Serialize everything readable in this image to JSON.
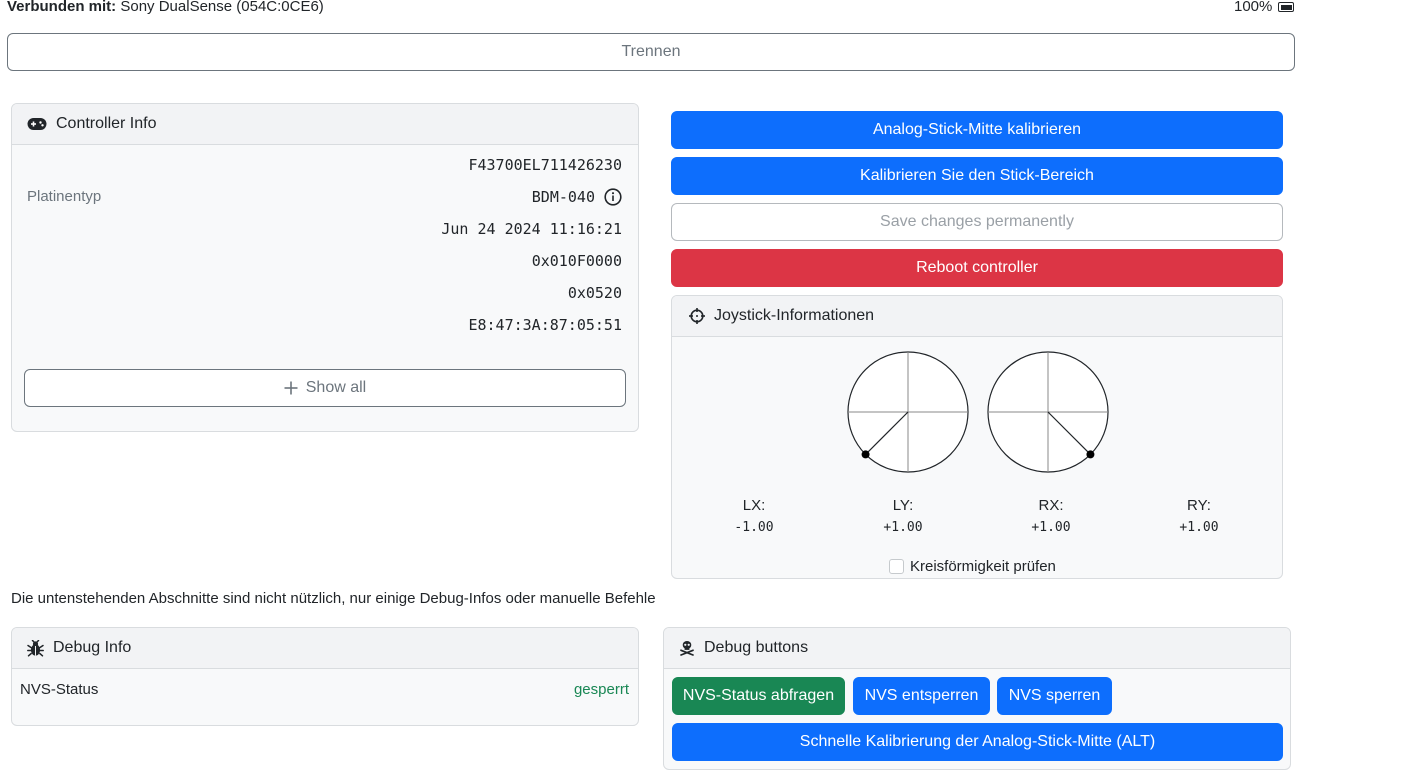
{
  "connection": {
    "label": "Verbunden mit:",
    "device": "Sony DualSense (054C:0CE6)",
    "battery": "100%",
    "battery_icon": "battery-icon"
  },
  "disconnect_label": "Trennen",
  "controller_info": {
    "title": "Controller Info",
    "icon": "gamepad-icon",
    "rows": [
      {
        "label": "",
        "value": "F43700EL711426230"
      },
      {
        "label": "Platinentyp",
        "value": "BDM-040",
        "has_info_icon": true
      },
      {
        "label": "",
        "value": "Jun 24 2024 11:16:21"
      },
      {
        "label": "",
        "value": "0x010F0000"
      },
      {
        "label": "",
        "value": "0x0520"
      },
      {
        "label": "",
        "value": "E8:47:3A:87:05:51"
      }
    ],
    "show_all_label": "Show all"
  },
  "actions": {
    "calibrate_center": "Analog-Stick-Mitte kalibrieren",
    "calibrate_range": "Kalibrieren Sie den Stick-Bereich",
    "save_permanently": "Save changes permanently",
    "reboot": "Reboot controller"
  },
  "joystick": {
    "title": "Joystick-Informationen",
    "icon": "crosshair-icon",
    "axes": [
      {
        "label": "LX:",
        "value": "-1.00"
      },
      {
        "label": "LY:",
        "value": "+1.00"
      },
      {
        "label": "RX:",
        "value": "+1.00"
      },
      {
        "label": "RY:",
        "value": "+1.00"
      }
    ],
    "left_stick": {
      "x": -1.0,
      "y": 1.0
    },
    "right_stick": {
      "x": 1.0,
      "y": 1.0
    },
    "circularity_label": "Kreisförmigkeit prüfen",
    "circularity_checked": false
  },
  "note": "Die untenstehenden Abschnitte sind nicht nützlich, nur einige Debug-Infos oder manuelle Befehle",
  "debug_info": {
    "title": "Debug Info",
    "icon": "bug-icon",
    "nvs_label": "NVS-Status",
    "nvs_value": "gesperrt"
  },
  "debug_buttons": {
    "title": "Debug buttons",
    "icon": "skull-crossbones-icon",
    "query": "NVS-Status abfragen",
    "unlock": "NVS entsperren",
    "lock": "NVS sperren",
    "quick_calibrate": "Schnelle Kalibrierung der Analog-Stick-Mitte (ALT)"
  },
  "colors": {
    "primary": "#0d6efd",
    "success": "#198754",
    "danger": "#dc3545",
    "secondary": "#6c757d"
  }
}
